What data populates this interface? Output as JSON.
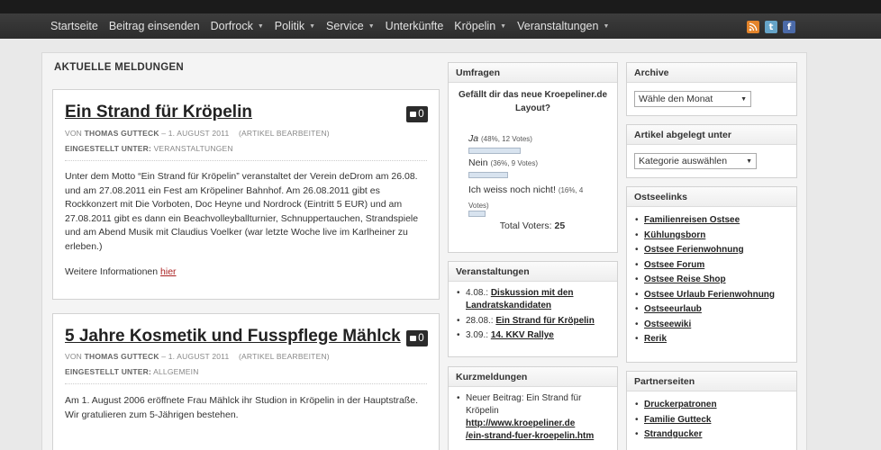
{
  "nav": {
    "items": [
      {
        "label": "Startseite",
        "dropdown": false
      },
      {
        "label": "Beitrag einsenden",
        "dropdown": false
      },
      {
        "label": "Dorfrock",
        "dropdown": true
      },
      {
        "label": "Politik",
        "dropdown": true
      },
      {
        "label": "Service",
        "dropdown": true
      },
      {
        "label": "Unterkünfte",
        "dropdown": false
      },
      {
        "label": "Kröpelin",
        "dropdown": true
      },
      {
        "label": "Veranstaltungen",
        "dropdown": true
      }
    ],
    "caret": "▼",
    "social": {
      "rss": "rss-icon",
      "twitter": "twitter-icon",
      "facebook": "facebook-icon"
    }
  },
  "main": {
    "heading": "AKTUELLE MELDUNGEN",
    "posts": [
      {
        "title": "Ein Strand für Kröpelin",
        "comments": "0",
        "von": "VON",
        "author": "THOMAS GUTTECK",
        "date": "– 1. AUGUST 2011",
        "edit": "(ARTIKEL BEARBEITEN)",
        "category_label": "EINGESTELLT UNTER:",
        "category": "VERANSTALTUNGEN",
        "body": "Unter dem Motto “Ein Strand für Kröpelin” veranstaltet der Verein deDrom am 26.08. und am 27.08.2011 ein Fest am Kröpeliner Bahnhof. Am 26.08.2011 gibt es Rockkonzert mit Die Vorboten, Doc Heyne und Nordrock (Eintritt 5 EUR) und am 27.08.2011 gibt es dann ein Beachvolleyballturnier, Schnuppertauchen, Strandspiele und am Abend Musik mit Claudius Voelker (war letzte Woche live im Karlheiner zu erleben.)",
        "more_prefix": "Weitere Informationen ",
        "more_link": "hier"
      },
      {
        "title": "5 Jahre Kosmetik und Fusspflege Mählck",
        "comments": "0",
        "von": "VON",
        "author": "THOMAS GUTTECK",
        "date": "– 1. AUGUST 2011",
        "edit": "(ARTIKEL BEARBEITEN)",
        "category_label": "EINGESTELLT UNTER:",
        "category": "ALLGEMEIN",
        "body": "Am 1. August 2006 eröffnete Frau Mählck ihr Studion in Kröpelin in der Hauptstraße. Wir gratulieren zum 5-Jährigen bestehen."
      }
    ]
  },
  "umfragen": {
    "title": "Umfragen",
    "question": "Gefällt dir das neue Kroepeliner.de Layout?",
    "answers": [
      {
        "label": "Ja",
        "stats": "(48%, 12 Votes)",
        "percent": 48
      },
      {
        "label": "Nein",
        "stats": "(36%, 9 Votes)",
        "percent": 36
      },
      {
        "label": "Ich weiss noch nicht!",
        "stats": "(16%, 4 Votes)",
        "percent": 16
      }
    ],
    "total_label": "Total Voters:",
    "total_value": "25"
  },
  "veranstaltungen": {
    "title": "Veranstaltungen",
    "items": [
      {
        "date": "4.08.:",
        "label": "Diskussion mit den Landratskandidaten"
      },
      {
        "date": "28.08.:",
        "label": "Ein Strand für Kröpelin"
      },
      {
        "date": "3.09.:",
        "label": "14. KKV Rallye"
      }
    ]
  },
  "kurzmeldungen": {
    "title": "Kurzmeldungen",
    "text": "Neuer Beitrag: Ein Strand für Kröpelin",
    "link1": "http://www.kroepeliner.de",
    "link2": "/ein-strand-fuer-kroepelin.htm"
  },
  "archive": {
    "title": "Archive",
    "select": "Wähle den Monat"
  },
  "artikel": {
    "title": "Artikel abgelegt unter",
    "select": "Kategorie auswählen"
  },
  "ostseelinks": {
    "title": "Ostseelinks",
    "items": [
      "Familienreisen Ostsee",
      "Kühlungsborn",
      "Ostsee Ferienwohnung",
      "Ostsee Forum",
      "Ostsee Reise Shop",
      "Ostsee Urlaub Ferienwohnung",
      "Ostseeurlaub",
      "Ostseewiki",
      "Rerik"
    ]
  },
  "partnerseiten": {
    "title": "Partnerseiten",
    "items": [
      "Druckerpatronen",
      "Familie Gutteck",
      "Strandgucker"
    ]
  }
}
